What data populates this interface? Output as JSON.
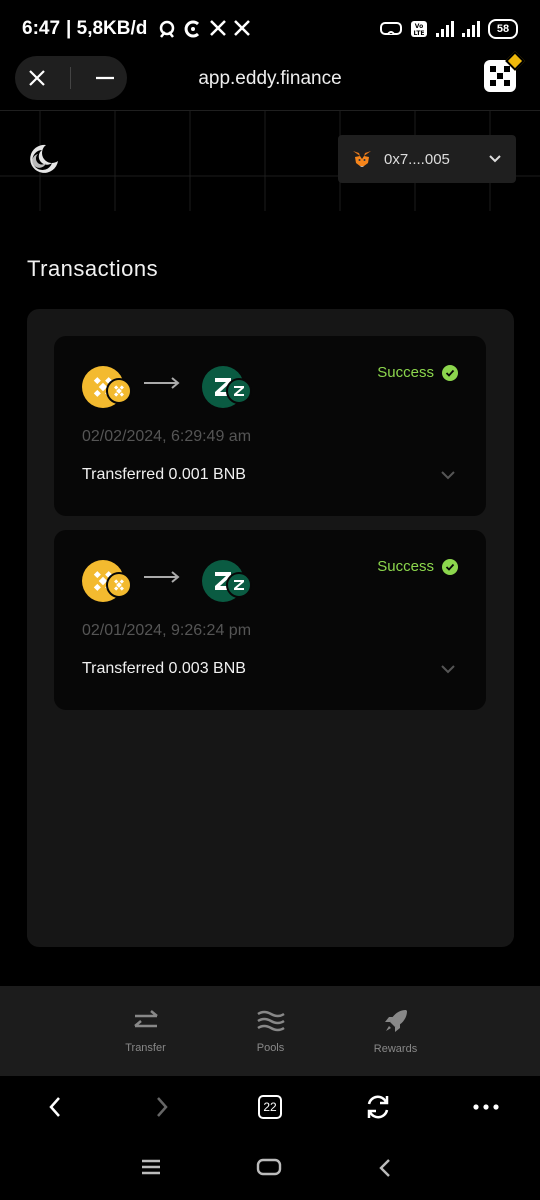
{
  "status_bar": {
    "time": "6:47",
    "data_rate": "| 5,8KB/d",
    "battery": "58"
  },
  "browser": {
    "url": "app.eddy.finance",
    "close_icon": "close-icon",
    "minimize_icon": "minimize-icon",
    "tab_count": "22"
  },
  "header": {
    "wallet_address": "0x7....005"
  },
  "page": {
    "title": "Transactions"
  },
  "transactions": [
    {
      "from_coin": "BNB",
      "to_coin": "ZETA",
      "status": "Success",
      "date": "02/02/2024, 6:29:49 am",
      "description": "Transferred 0.001 BNB"
    },
    {
      "from_coin": "BNB",
      "to_coin": "ZETA",
      "status": "Success",
      "date": "02/01/2024, 9:26:24 pm",
      "description": "Transferred 0.003 BNB"
    }
  ],
  "app_nav": {
    "items": [
      {
        "label": "Transfer",
        "icon": "transfer-icon"
      },
      {
        "label": "Pools",
        "icon": "pools-icon"
      },
      {
        "label": "Rewards",
        "icon": "rocket-icon"
      }
    ]
  },
  "colors": {
    "success": "#8cd64d",
    "bnb": "#f3ba2f",
    "zeta": "#0a5b42"
  }
}
